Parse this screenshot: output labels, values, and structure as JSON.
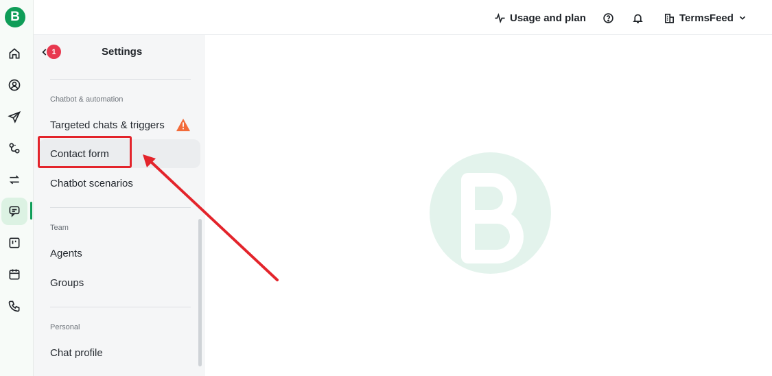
{
  "app": {
    "logo_letter": "B"
  },
  "topbar": {
    "usage_label": "Usage and plan",
    "account_name": "TermsFeed"
  },
  "settings": {
    "title": "Settings",
    "badge_count": "1",
    "sections": [
      {
        "label": "Chatbot & automation",
        "items": [
          "Targeted chats & triggers",
          "Contact form",
          "Chatbot scenarios"
        ]
      },
      {
        "label": "Team",
        "items": [
          "Agents",
          "Groups"
        ]
      },
      {
        "label": "Personal",
        "items": [
          "Chat profile"
        ]
      }
    ]
  },
  "colors": {
    "brand": "#0f9d58",
    "annotation": "#e3242b",
    "warning": "#f26b3a",
    "badge": "#e8384f"
  },
  "rail_icons": [
    "home-icon",
    "contacts-icon",
    "send-icon",
    "automation-icon",
    "transfer-icon",
    "chat-icon",
    "board-icon",
    "calendar-icon",
    "phone-icon"
  ]
}
